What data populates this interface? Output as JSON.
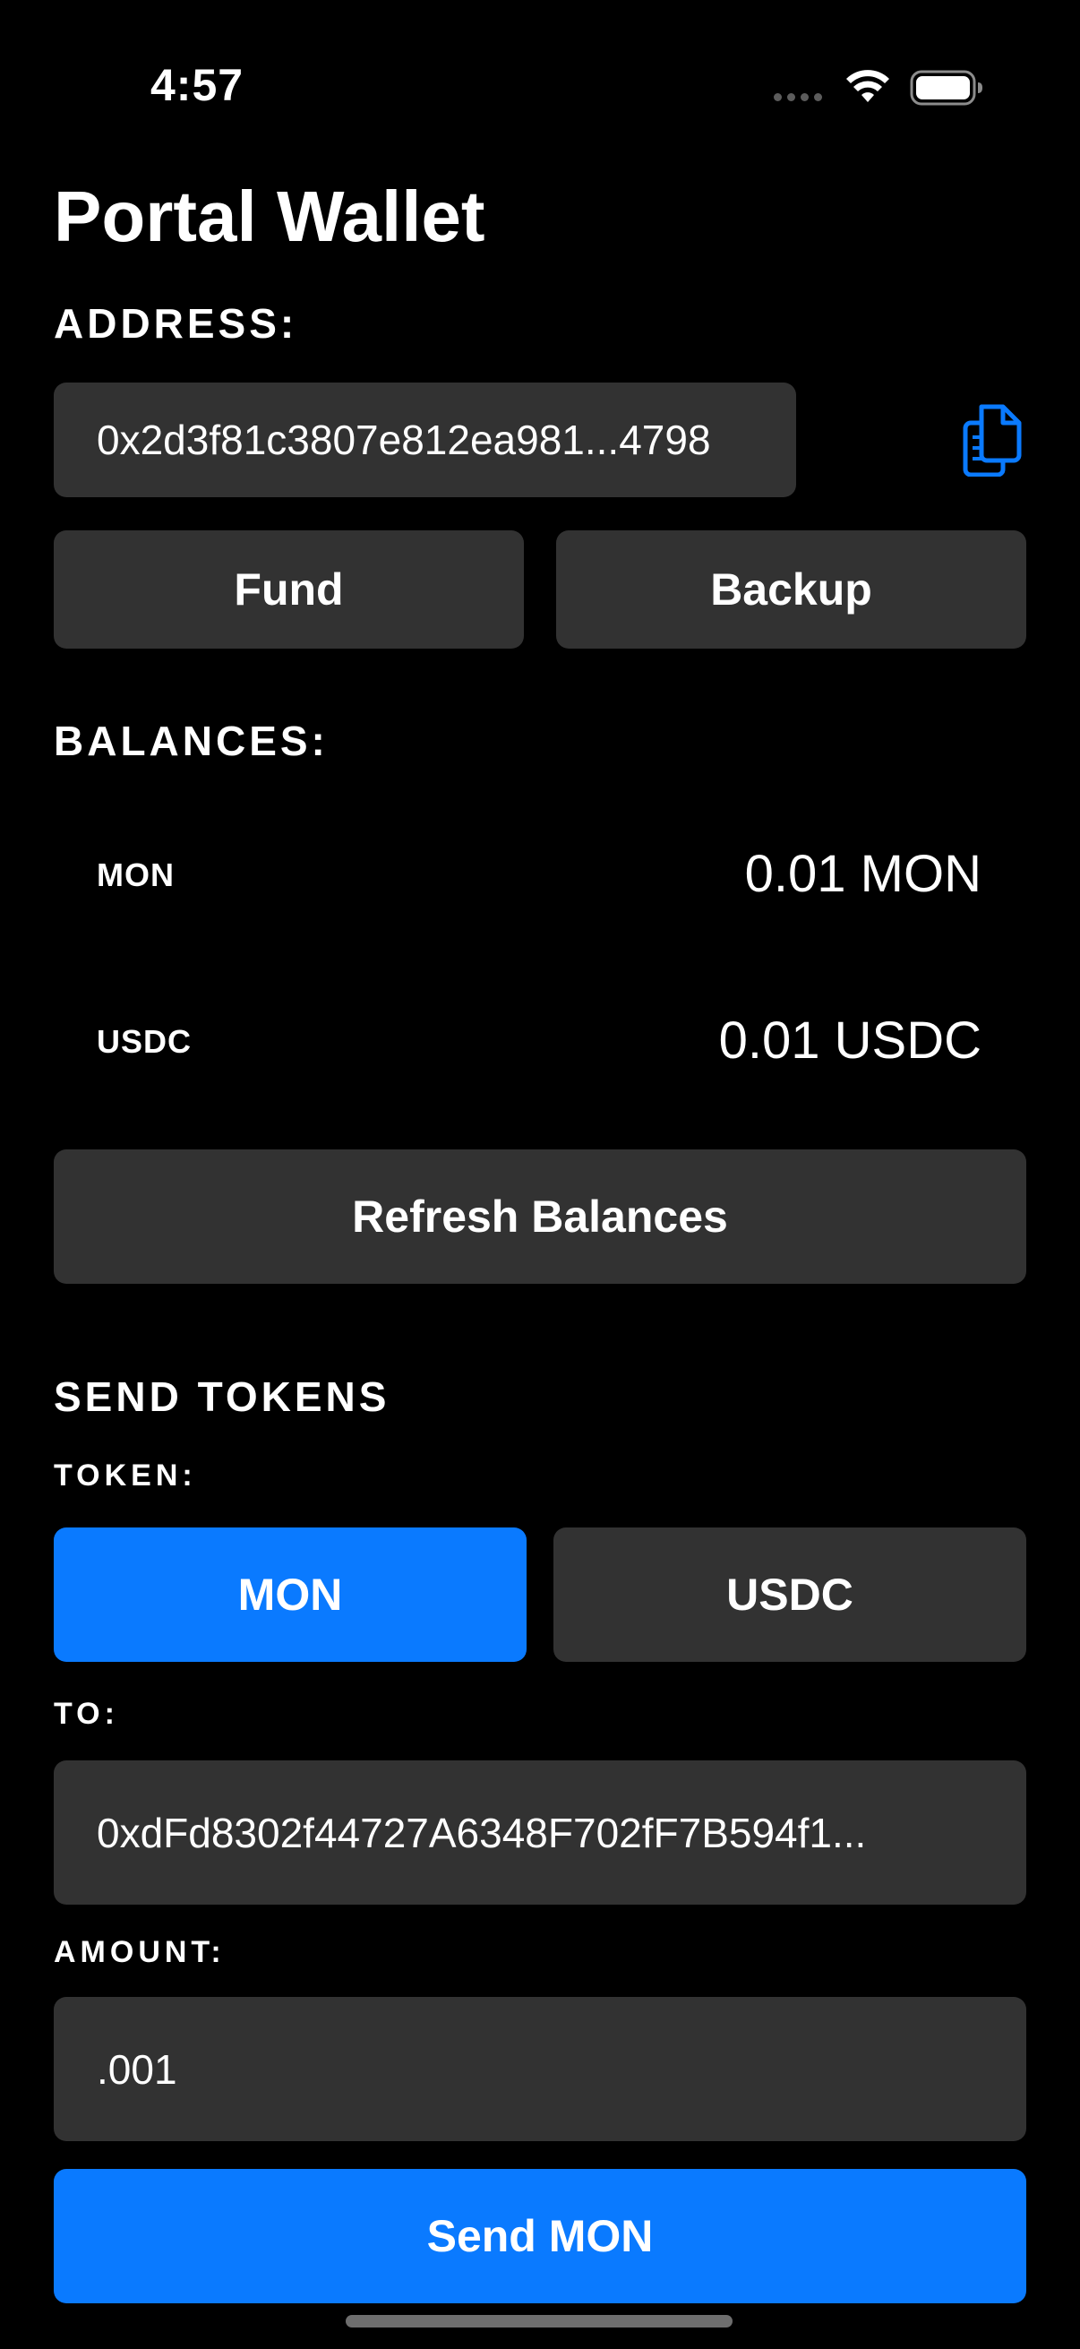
{
  "status_bar": {
    "time": "4:57"
  },
  "title": "Portal Wallet",
  "address": {
    "label": "ADDRESS:",
    "value": "0x2d3f81c3807e812ea981...4798",
    "copy_icon": "copy-document-icon"
  },
  "actions": {
    "fund": "Fund",
    "backup": "Backup"
  },
  "balances": {
    "label": "BALANCES:",
    "items": [
      {
        "name": "MON",
        "value": "0.01 MON"
      },
      {
        "name": "USDC",
        "value": "0.01 USDC"
      }
    ],
    "refresh": "Refresh Balances"
  },
  "send": {
    "heading": "SEND TOKENS",
    "token_label": "TOKEN:",
    "tokens": [
      {
        "label": "MON",
        "selected": true
      },
      {
        "label": "USDC",
        "selected": false
      }
    ],
    "to_label": "TO:",
    "to_value": "0xdFd8302f44727A6348F702fF7B594f1...",
    "amount_label": "AMOUNT:",
    "amount_value": ".001",
    "submit": "Send MON"
  },
  "colors": {
    "background": "#000000",
    "surface": "#323232",
    "accent": "#0a7aff"
  }
}
